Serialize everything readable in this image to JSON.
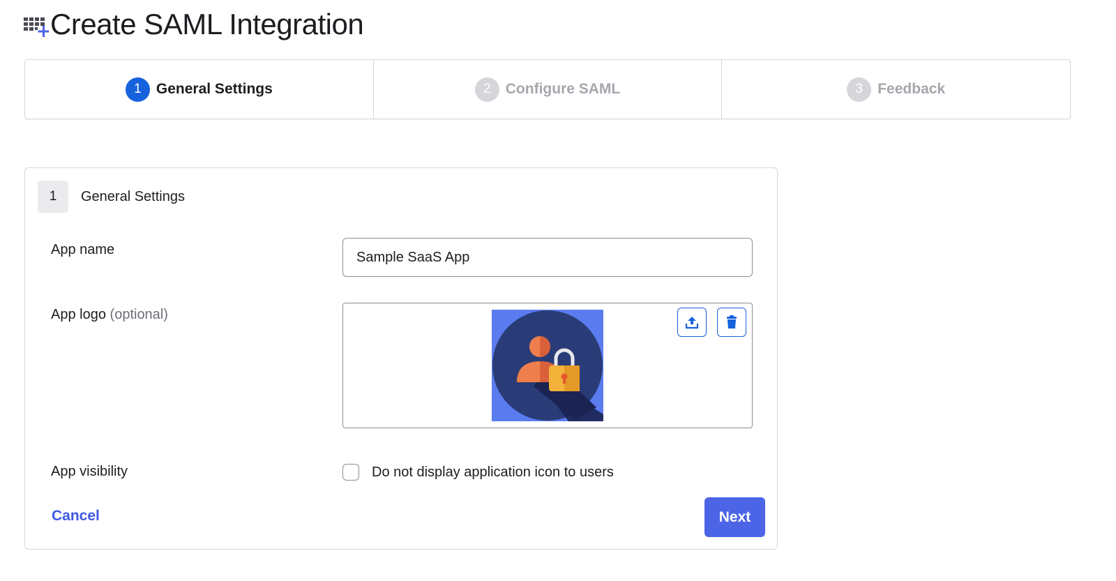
{
  "page": {
    "title": "Create SAML Integration",
    "icon": "app-grid-plus-icon"
  },
  "stepper": {
    "steps": [
      {
        "number": "1",
        "label": "General Settings",
        "state": "active"
      },
      {
        "number": "2",
        "label": "Configure SAML",
        "state": "inactive"
      },
      {
        "number": "3",
        "label": "Feedback",
        "state": "inactive"
      }
    ]
  },
  "section": {
    "number": "1",
    "title": "General Settings"
  },
  "fields": {
    "app_name": {
      "label": "App name",
      "value": "Sample SaaS App"
    },
    "app_logo": {
      "label": "App logo",
      "optional_label": "(optional)",
      "upload_icon": "upload-icon",
      "delete_icon": "trash-icon",
      "logo_icon": "user-lock-icon"
    },
    "app_visibility": {
      "label": "App visibility",
      "checkbox_label": "Do not display application icon to users",
      "checked": false
    }
  },
  "actions": {
    "cancel_label": "Cancel",
    "next_label": "Next"
  },
  "colors": {
    "primary": "#1662dd",
    "button": "#4c64e6",
    "link": "#3f59e4",
    "inactive_step": "#a6a6ad",
    "logo_background": "#5b7cef",
    "logo_circle": "#2a3c77"
  }
}
